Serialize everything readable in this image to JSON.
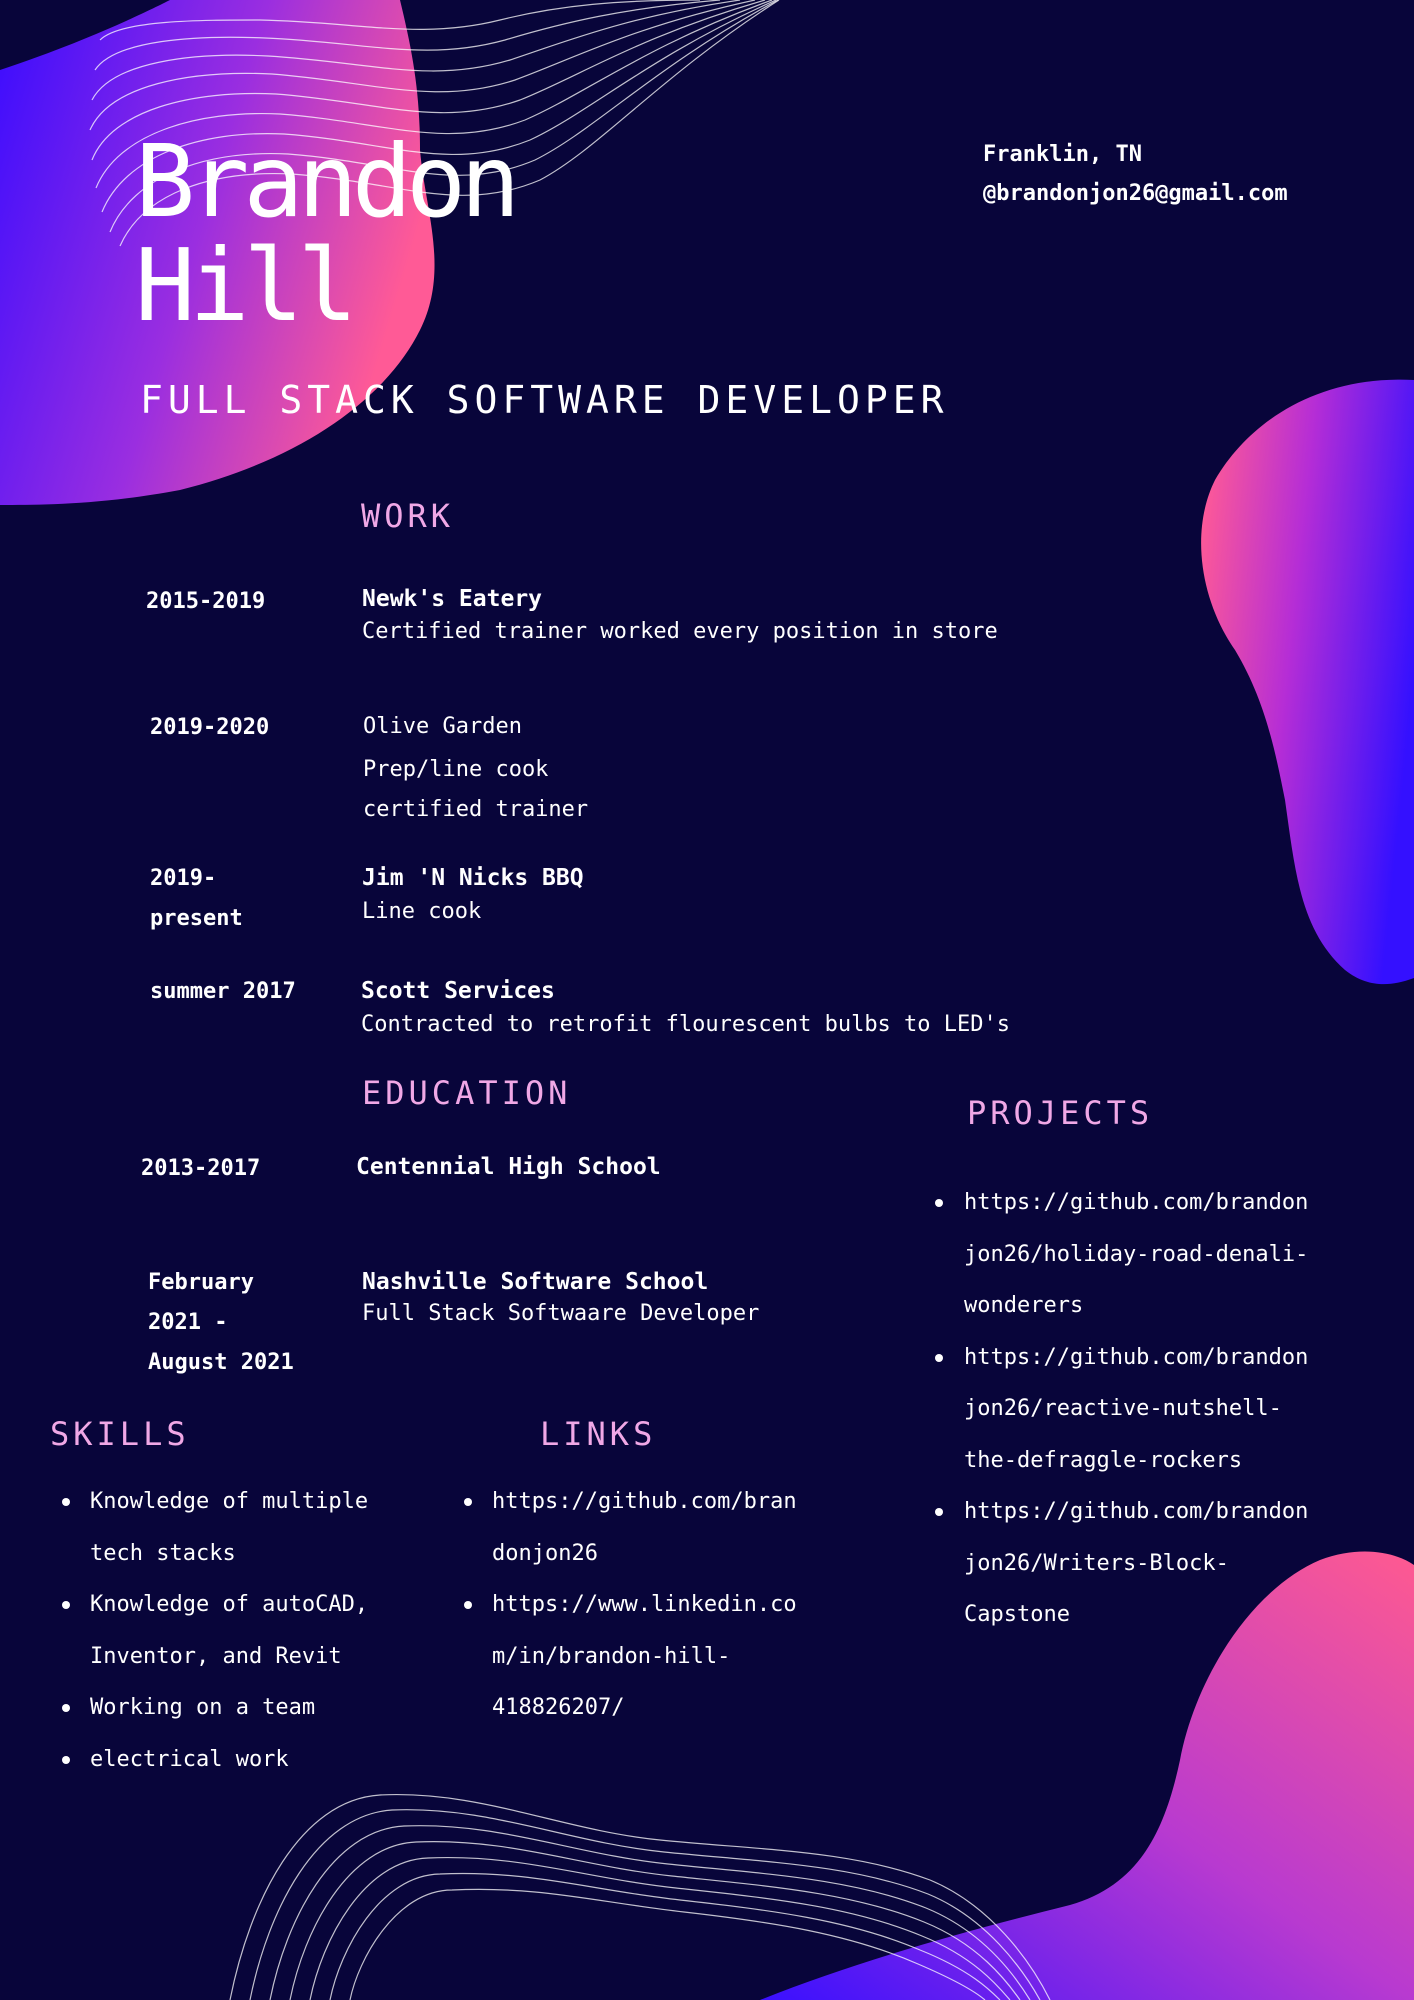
{
  "header": {
    "first_name": "Brandon",
    "last_name": "Hill",
    "job_title": "FULL STACK SOFTWARE DEVELOPER",
    "location": "Franklin, TN",
    "email": "@brandonjon26@gmail.com"
  },
  "work": {
    "heading": "WORK",
    "entries": [
      {
        "date": "2015-2019",
        "employer": "Newk's Eatery",
        "line1": "Certified trainer worked every position in store"
      },
      {
        "date": "2019-2020",
        "employer": "Olive Garden",
        "line1": "Prep/line cook",
        "line2": "certified trainer"
      },
      {
        "date_line1": "2019-",
        "date_line2": "present",
        "employer": "Jim 'N Nicks BBQ",
        "line1": "Line cook"
      },
      {
        "date": "summer 2017",
        "employer": "Scott Services",
        "line1": "Contracted to retrofit flourescent bulbs to LED's"
      }
    ]
  },
  "education": {
    "heading": "EDUCATION",
    "entries": [
      {
        "date": "2013-2017",
        "school": "Centennial High School"
      },
      {
        "date_line1": "February",
        "date_line2": "2021 -",
        "date_line3": "August 2021",
        "school": "Nashville Software School",
        "program": "Full Stack Softwaare Developer"
      }
    ]
  },
  "skills": {
    "heading": "SKILLS",
    "items": [
      {
        "line1": "Knowledge of multiple",
        "line2": "tech stacks"
      },
      {
        "line1": "Knowledge of autoCAD,",
        "line2": "Inventor, and Revit"
      },
      {
        "line1": "Working on a team"
      },
      {
        "line1": "electrical work"
      }
    ]
  },
  "links": {
    "heading": "LINKS",
    "items": [
      {
        "line1": "https://github.com/bran",
        "line2": "donjon26"
      },
      {
        "line1": "https://www.linkedin.co",
        "line2": "m/in/brandon-hill-",
        "line3": "418826207/"
      }
    ]
  },
  "projects": {
    "heading": "PROJECTS",
    "items": [
      {
        "line1": "https://github.com/brandon",
        "line2": "jon26/holiday-road-denali-",
        "line3": "wonderers"
      },
      {
        "line1": "https://github.com/brandon",
        "line2": "jon26/reactive-nutshell-",
        "line3": "the-defraggle-rockers"
      },
      {
        "line1": "https://github.com/brandon",
        "line2": "jon26/Writers-Block-",
        "line3": "Capstone"
      }
    ]
  },
  "colors": {
    "background": "#08053a",
    "heading_pink": "#f0a8e6",
    "blob_blue": "#3a0cff",
    "blob_pink": "#ff5aa0"
  }
}
